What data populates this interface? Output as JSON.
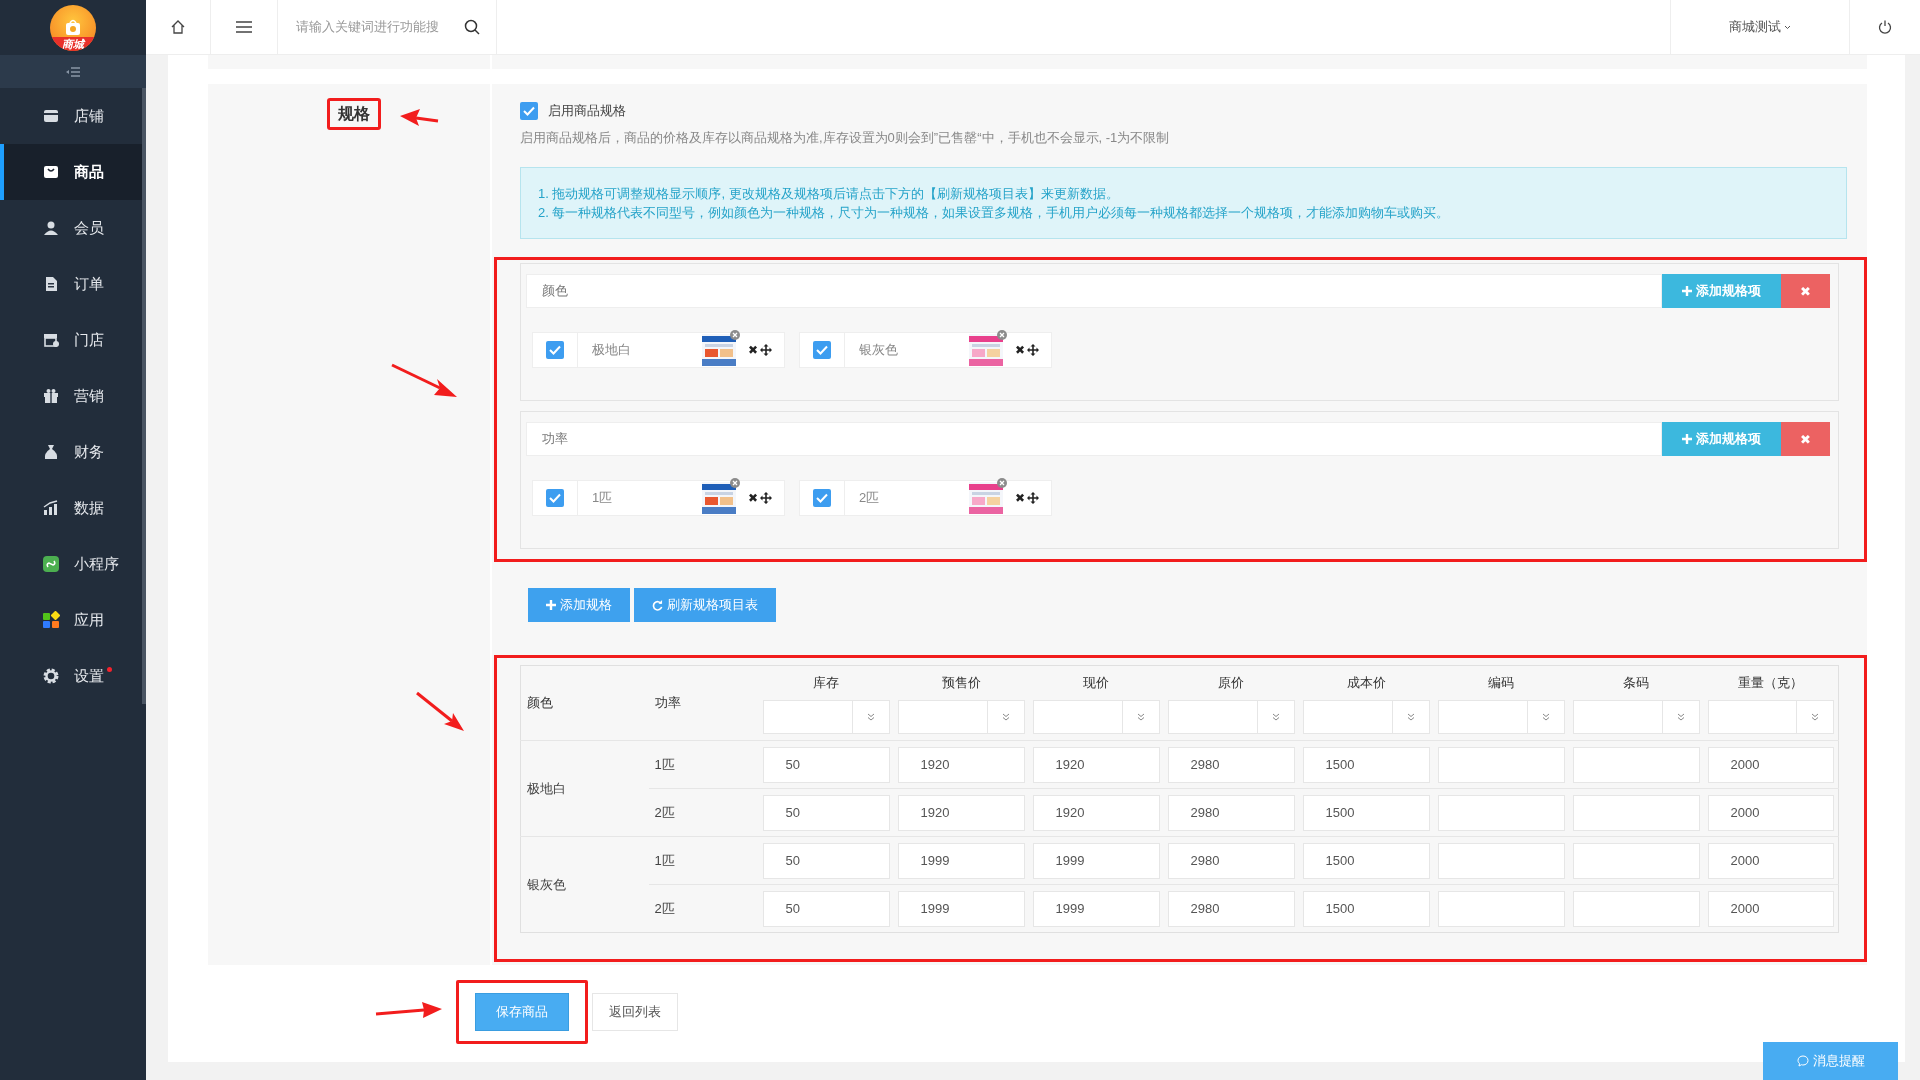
{
  "topbar": {
    "search_placeholder": "请输入关键词进行功能搜",
    "user": "商城测试"
  },
  "sidebar": {
    "logo_text": "商城",
    "items": [
      {
        "label": "店铺",
        "selected": false,
        "dot": false
      },
      {
        "label": "商品",
        "selected": true,
        "dot": false
      },
      {
        "label": "会员",
        "selected": false,
        "dot": false
      },
      {
        "label": "订单",
        "selected": false,
        "dot": false
      },
      {
        "label": "门店",
        "selected": false,
        "dot": false
      },
      {
        "label": "营销",
        "selected": false,
        "dot": false
      },
      {
        "label": "财务",
        "selected": false,
        "dot": false
      },
      {
        "label": "数据",
        "selected": false,
        "dot": false
      },
      {
        "label": "小程序",
        "selected": false,
        "dot": false
      },
      {
        "label": "应用",
        "selected": false,
        "dot": false
      },
      {
        "label": "设置",
        "selected": false,
        "dot": true
      }
    ]
  },
  "form": {
    "label": "规格",
    "enable": {
      "label": "启用商品规格",
      "checked": true
    },
    "hint": "启用商品规格后，商品的价格及库存以商品规格为准,库存设置为0则会到”已售罄“中，手机也不会显示, -1为不限制",
    "notes": [
      "1. 拖动规格可调整规格显示顺序, 更改规格及规格项后请点击下方的【刷新规格项目表】来更新数据。",
      "2. 每一种规格代表不同型号，例如颜色为一种规格，尺寸为一种规格，如果设置多规格，手机用户必须每一种规格都选择一个规格项，才能添加购物车或购买。"
    ],
    "specs": [
      {
        "name": "颜色",
        "add_button": "添加规格项",
        "remove_button": "✖",
        "items": [
          {
            "value": "极地白",
            "checked": true,
            "remove": "✖"
          },
          {
            "value": "银灰色",
            "checked": true,
            "remove": "✖"
          }
        ]
      },
      {
        "name": "功率",
        "add_button": "添加规格项",
        "remove_button": "✖",
        "items": [
          {
            "value": "1匹",
            "checked": true,
            "remove": "✖"
          },
          {
            "value": "2匹",
            "checked": true,
            "remove": "✖"
          }
        ]
      }
    ],
    "add_spec_button": "添加规格",
    "refresh_button": "刷新规格项目表",
    "table": {
      "columns": [
        "颜色",
        "功率",
        "库存",
        "预售价",
        "现价",
        "原价",
        "成本价",
        "编码",
        "条码",
        "重量（克）"
      ],
      "groups": [
        {
          "name": "极地白",
          "rows": [
            {
              "power": "1匹",
              "stock": "50",
              "presale_price": "1920",
              "price": "1920",
              "original_price": "2980",
              "cost_price": "1500",
              "weight": "2000"
            },
            {
              "power": "2匹",
              "stock": "50",
              "presale_price": "1920",
              "price": "1920",
              "original_price": "2980",
              "cost_price": "1500",
              "weight": "2000"
            }
          ]
        },
        {
          "name": "银灰色",
          "rows": [
            {
              "power": "1匹",
              "stock": "50",
              "presale_price": "1999",
              "price": "1999",
              "original_price": "2980",
              "cost_price": "1500",
              "weight": "2000"
            },
            {
              "power": "2匹",
              "stock": "50",
              "presale_price": "1999",
              "price": "1999",
              "original_price": "2980",
              "cost_price": "1500",
              "weight": "2000"
            }
          ]
        }
      ]
    }
  },
  "footer": {
    "save_button": "保存商品",
    "back_button": "返回列表"
  },
  "message_button": "消息提醒"
}
